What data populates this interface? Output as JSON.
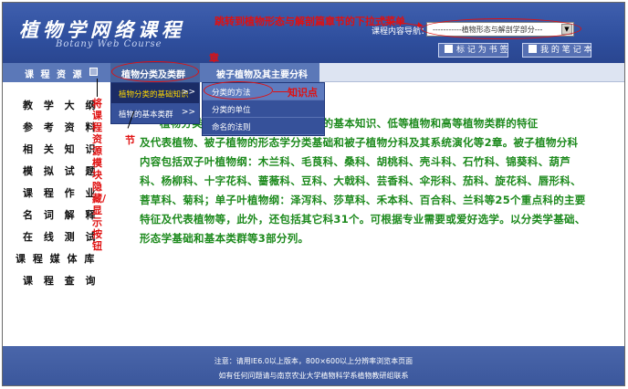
{
  "header": {
    "logo_cn": "植物学网络课程",
    "logo_en": "Botany Web Course",
    "nav_label": "课程内容导航：",
    "nav_select_value": "-----------植物形态与解剖学部分---",
    "bookmark_button": "标 记 为 书 签",
    "notes_button": "我 的 笔 记 本"
  },
  "annotations": {
    "top_dropdown": "跳转到植物形态与解剖篇章节的下拉式菜单",
    "chapter": "章",
    "section": "节",
    "knowledge_point": "知识点",
    "sidebar_toggle": "将课程资源模块隐藏/显示按钮"
  },
  "menubar": {
    "resources_label": "课 程 资 源",
    "tab_classify": "植物分类及类群",
    "tab_angiosperm": "被子植物及其主要分科"
  },
  "sidebar": {
    "items": [
      "教 学 大 纲",
      "参 考 资 料",
      "相 关 知 识",
      "模 拟 试 题",
      "课 程 作 业",
      "名 词 解 释",
      "在 线 测 试",
      "课 程 媒 体 库",
      "课 程 查 询"
    ]
  },
  "menu_sections": [
    {
      "label": "植物分类的基础知识",
      "chevron": ">>"
    },
    {
      "label": "植物的基本类群",
      "chevron": ">>"
    }
  ],
  "menu_points": [
    "分类的方法",
    "分类的单位",
    "命名的法则"
  ],
  "main": {
    "paragraph_head": "植物分类",
    "paragraph_lead": "物分类的基本知识、低等植物和高等植物类群的特征",
    "paragraph": "及代表植物、被子植物的形态学分类基础和被子植物分科及其系统演化等2章。被子植物分科内容包括双子叶植物纲：木兰科、毛茛科、桑科、胡桃科、壳斗科、石竹科、锦葵科、葫芦科、杨柳科、十字花科、蔷薇科、豆科、大戟科、芸香科、伞形科、茄科、旋花科、唇形科、菩草科、菊科；单子叶植物纲：泽泻科、莎草科、禾本科、百合科、兰科等25个重点科的主要特征及代表植物等，此外，还包括其它科31个。可根据专业需要或爱好选学。以分类学基础、形态学基础和基本类群等3部分列。"
  },
  "footer": {
    "line1": "注意：请用IE6.0以上版本，800×600以上分辨率浏览本页面",
    "line2": "如有任何问题请与南京农业大学植物科学系植物教研组联系"
  }
}
